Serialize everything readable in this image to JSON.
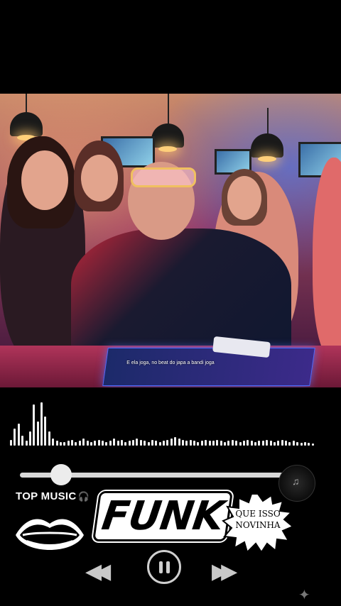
{
  "video": {
    "subtitle": "E ela joga, no beat do japa a bandi joga"
  },
  "player": {
    "label": "TOP MUSIC",
    "headphones_icon": "🎧",
    "progress_fraction": 0.15,
    "prev_icon": "◀◀",
    "next_icon": "▶▶",
    "disc_icon": "♫"
  },
  "logo": {
    "title": "FUNK",
    "badge_line1": "QUE ISSO",
    "badge_line2": "NOVINHA"
  },
  "colors": {
    "track": "#d8d8d8",
    "visualizer": "#f2f2f2"
  },
  "visualizer_levels": [
    0.12,
    0.35,
    0.45,
    0.2,
    0.1,
    0.3,
    0.85,
    0.5,
    0.9,
    0.6,
    0.3,
    0.15,
    0.1,
    0.08,
    0.08,
    0.1,
    0.12,
    0.08,
    0.1,
    0.15,
    0.1,
    0.08,
    0.1,
    0.12,
    0.1,
    0.08,
    0.1,
    0.14,
    0.1,
    0.12,
    0.08,
    0.1,
    0.12,
    0.14,
    0.12,
    0.1,
    0.08,
    0.12,
    0.1,
    0.08,
    0.1,
    0.12,
    0.14,
    0.18,
    0.14,
    0.12,
    0.1,
    0.12,
    0.1,
    0.08,
    0.1,
    0.12,
    0.1,
    0.1,
    0.12,
    0.1,
    0.08,
    0.1,
    0.12,
    0.1,
    0.08,
    0.1,
    0.12,
    0.1,
    0.08,
    0.1,
    0.1,
    0.12,
    0.1,
    0.08,
    0.1,
    0.12,
    0.1,
    0.08,
    0.1,
    0.08,
    0.06,
    0.08,
    0.06,
    0.05
  ]
}
